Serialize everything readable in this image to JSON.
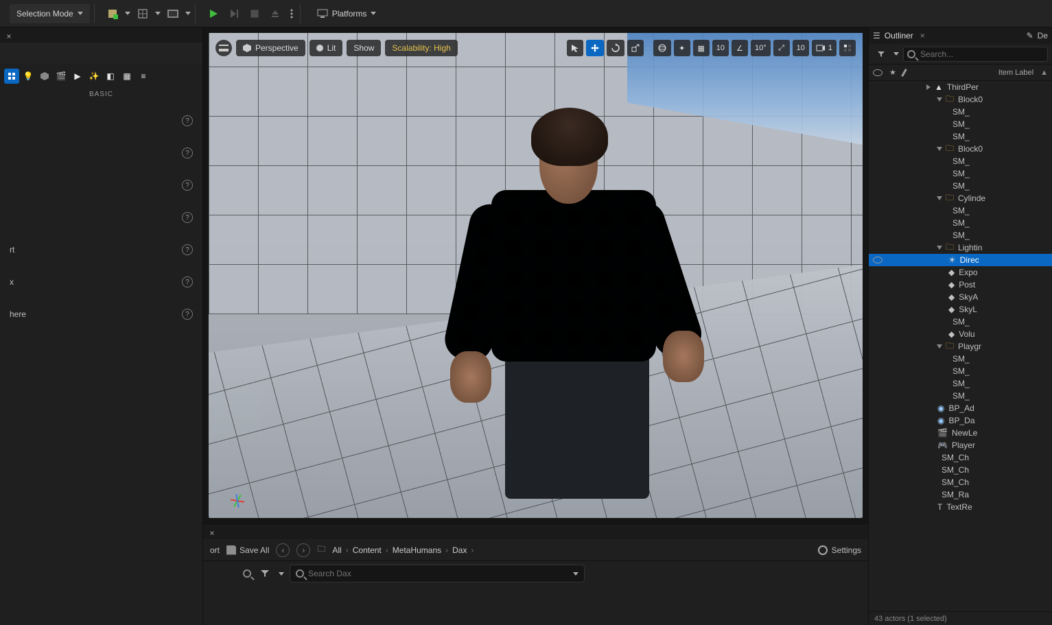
{
  "toolbar": {
    "selection_mode": "Selection Mode",
    "platforms": "Platforms"
  },
  "left_panel": {
    "filter_label": "BASIC",
    "items": [
      {
        "label": ""
      },
      {
        "label": ""
      },
      {
        "label": ""
      },
      {
        "label": ""
      },
      {
        "label": "rt"
      },
      {
        "label": "x"
      },
      {
        "label": "here"
      }
    ]
  },
  "viewport": {
    "perspective": "Perspective",
    "lit": "Lit",
    "show": "Show",
    "scalability": "Scalability: High",
    "grid_snap": "10",
    "angle_snap": "10°",
    "scale_snap": "10",
    "camera_speed": "1"
  },
  "content_browser": {
    "import_label": "ort",
    "save_all": "Save All",
    "breadcrumb": [
      "All",
      "Content",
      "MetaHumans",
      "Dax"
    ],
    "settings": "Settings",
    "search_placeholder": "Search Dax"
  },
  "outliner": {
    "tab": "Outliner",
    "details_tab": "De",
    "search_placeholder": "Search...",
    "column": "Item Label",
    "status": "43 actors (1 selected)",
    "tree": [
      {
        "t": "level",
        "label": "ThirdPer",
        "d": 0
      },
      {
        "t": "folder",
        "label": "Block0",
        "d": 1,
        "open": true
      },
      {
        "t": "mesh",
        "label": "SM_",
        "d": 2
      },
      {
        "t": "mesh",
        "label": "SM_",
        "d": 2
      },
      {
        "t": "mesh",
        "label": "SM_",
        "d": 2
      },
      {
        "t": "folder",
        "label": "Block0",
        "d": 1,
        "open": true
      },
      {
        "t": "mesh",
        "label": "SM_",
        "d": 2
      },
      {
        "t": "mesh",
        "label": "SM_",
        "d": 2
      },
      {
        "t": "mesh",
        "label": "SM_",
        "d": 2
      },
      {
        "t": "folder",
        "label": "Cylinde",
        "d": 1,
        "open": true
      },
      {
        "t": "mesh",
        "label": "SM_",
        "d": 2
      },
      {
        "t": "mesh",
        "label": "SM_",
        "d": 2
      },
      {
        "t": "mesh",
        "label": "SM_",
        "d": 2
      },
      {
        "t": "folder",
        "label": "Lightin",
        "d": 1,
        "open": true,
        "sel_next": true
      },
      {
        "t": "light",
        "label": "Direc",
        "d": 2,
        "selected": true
      },
      {
        "t": "actor",
        "label": "Expo",
        "d": 2
      },
      {
        "t": "actor",
        "label": "Post",
        "d": 2
      },
      {
        "t": "actor",
        "label": "SkyA",
        "d": 2
      },
      {
        "t": "actor",
        "label": "SkyL",
        "d": 2
      },
      {
        "t": "mesh",
        "label": "SM_",
        "d": 2
      },
      {
        "t": "actor",
        "label": "Volu",
        "d": 2
      },
      {
        "t": "folder",
        "label": "Playgr",
        "d": 1,
        "open": true
      },
      {
        "t": "mesh",
        "label": "SM_",
        "d": 2
      },
      {
        "t": "mesh",
        "label": "SM_",
        "d": 2
      },
      {
        "t": "mesh",
        "label": "SM_",
        "d": 2
      },
      {
        "t": "mesh",
        "label": "SM_",
        "d": 2
      },
      {
        "t": "bp",
        "label": "BP_Ad",
        "d": 1
      },
      {
        "t": "bp",
        "label": "BP_Da",
        "d": 1
      },
      {
        "t": "seq",
        "label": "NewLe",
        "d": 1
      },
      {
        "t": "player",
        "label": "Player",
        "d": 1
      },
      {
        "t": "mesh",
        "label": "SM_Ch",
        "d": 1
      },
      {
        "t": "mesh",
        "label": "SM_Ch",
        "d": 1
      },
      {
        "t": "mesh",
        "label": "SM_Ch",
        "d": 1
      },
      {
        "t": "mesh",
        "label": "SM_Ra",
        "d": 1
      },
      {
        "t": "text",
        "label": "TextRe",
        "d": 1
      }
    ]
  }
}
